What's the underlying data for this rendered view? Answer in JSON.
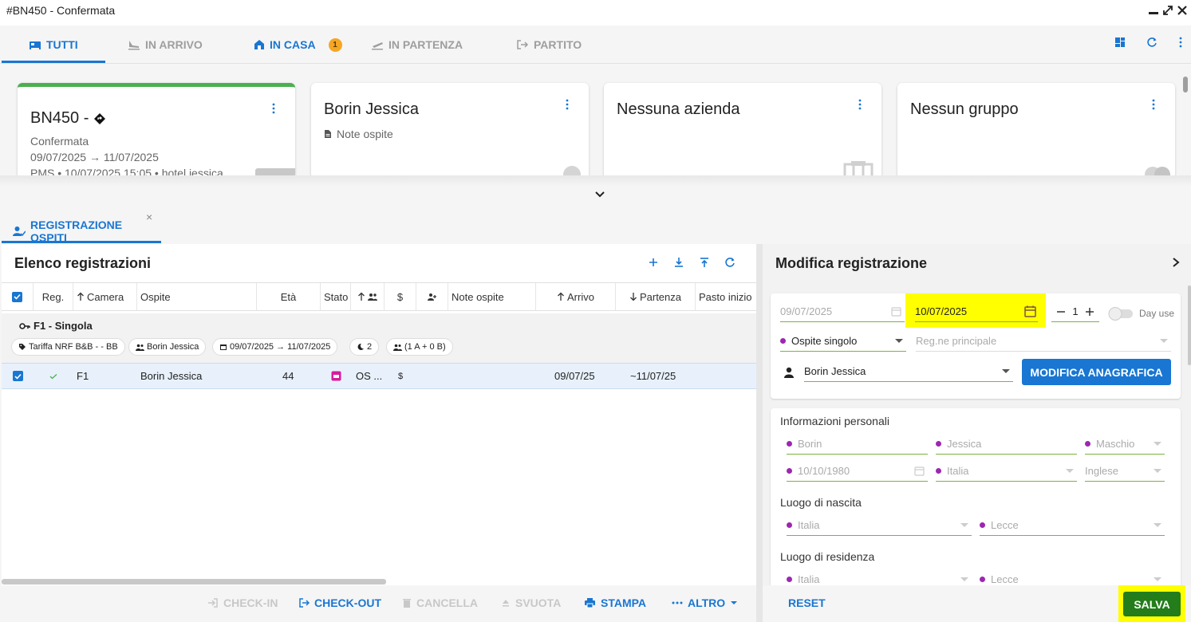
{
  "window": {
    "title": "#BN450 - Confermata"
  },
  "top_tabs": [
    {
      "label": "TUTTI",
      "icon": "bed-icon",
      "active": true
    },
    {
      "label": "IN ARRIVO",
      "icon": "plane-landing-icon"
    },
    {
      "label": "IN CASA",
      "icon": "house-icon",
      "badge": "1"
    },
    {
      "label": "IN PARTENZA",
      "icon": "plane-takeoff-icon"
    },
    {
      "label": "PARTITO",
      "icon": "exit-icon"
    }
  ],
  "cards": {
    "booking": {
      "title": "BN450 -",
      "status": "Confermata",
      "dates": "09/07/2025 → 11/07/2025",
      "meta": "PMS • 10/07/2025 15:05 • hotel.jessica"
    },
    "guest": {
      "title": "Borin Jessica",
      "note": "Note ospite"
    },
    "company": {
      "title": "Nessuna azienda"
    },
    "group": {
      "title": "Nessun gruppo"
    }
  },
  "registration_tab": {
    "label": "REGISTRAZIONE OSPITI",
    "close": "×"
  },
  "list": {
    "title": "Elenco registrazioni",
    "columns": [
      "Reg.",
      "Camera",
      "Ospite",
      "Età",
      "Stato",
      "$",
      "Note ospite",
      "Arrivo",
      "Partenza",
      "Pasto inizio"
    ],
    "group": {
      "title": "F1 - Singola",
      "chips": [
        "Tariffa NRF B&B - - BB",
        "Borin Jessica",
        "09/07/2025 → 11/07/2025",
        "2",
        "(1 A + 0 B)"
      ]
    },
    "row": {
      "camera": "F1",
      "ospite": "Borin Jessica",
      "eta": "44",
      "stato": "OS ...",
      "price": "$",
      "arrivo": "09/07/25",
      "partenza": "~11/07/25"
    }
  },
  "footer_left": {
    "checkin": "CHECK-IN",
    "checkout": "CHECK-OUT",
    "cancella": "CANCELLA",
    "svuota": "SVUOTA",
    "stampa": "STAMPA",
    "altro": "ALTRO"
  },
  "edit": {
    "title": "Modifica registrazione",
    "from_date": "09/07/2025",
    "to_date": "10/07/2025",
    "guests_count": "1",
    "day_use_label": "Day use",
    "guest_type": "Ospite singolo",
    "reg_principale_placeholder": "Reg.ne principale",
    "guest_name": "Borin Jessica",
    "modifica_button": "MODIFICA ANAGRAFICA",
    "personal_title": "Informazioni personali",
    "surname": "Borin",
    "name": "Jessica",
    "gender": "Maschio",
    "birth_date": "10/10/1980",
    "nationality": "Italia",
    "language": "Inglese",
    "birthplace_title": "Luogo di nascita",
    "birth_country": "Italia",
    "birth_city": "Lecce",
    "residence_title": "Luogo di residenza",
    "res_country": "Italia",
    "res_city": "Lecce"
  },
  "footer_right": {
    "reset": "RESET",
    "salva": "SALVA"
  },
  "colors": {
    "accent": "#1976d2",
    "confirm_green": "#4caf50",
    "save_green": "#237d1a",
    "highlight": "#ffff00",
    "purple_dot": "#9c27b0"
  }
}
